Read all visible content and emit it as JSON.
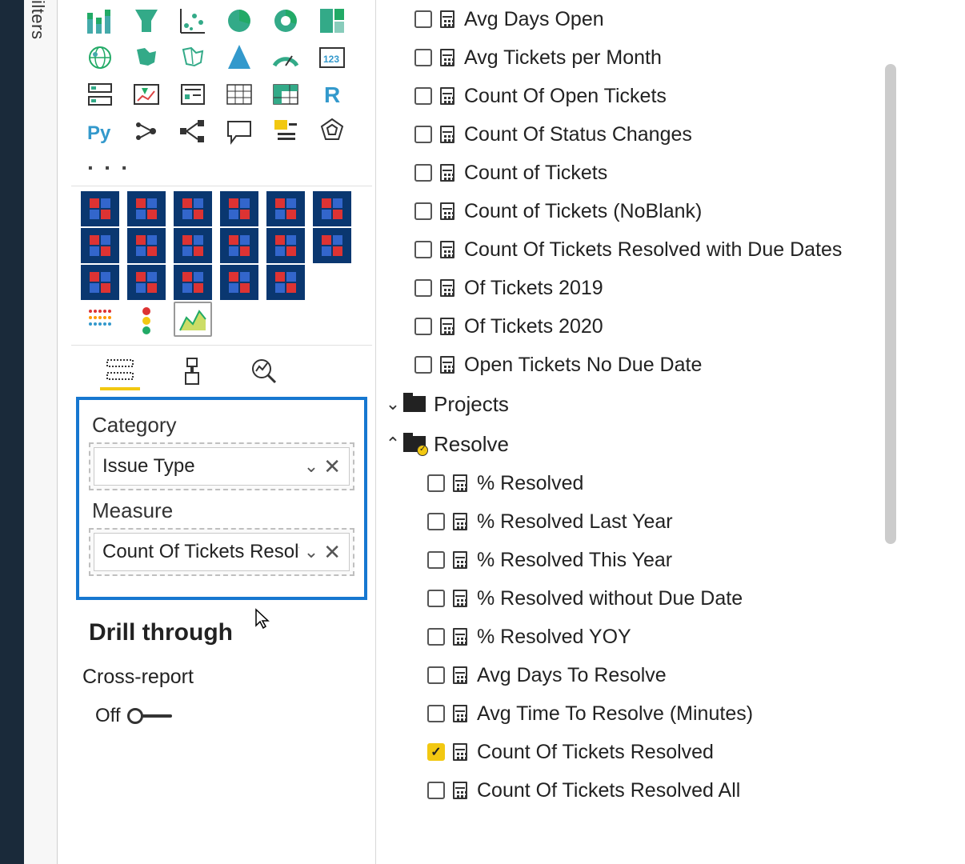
{
  "filters_label": "ilters",
  "ellipsis": "· · ·",
  "wells": {
    "category_label": "Category",
    "category_value": "Issue Type",
    "measure_label": "Measure",
    "measure_value": "Count Of Tickets Resolv"
  },
  "drill": {
    "header": "Drill through",
    "cross_report": "Cross-report",
    "toggle_state": "Off"
  },
  "fields": {
    "measures_group1": [
      "Avg Days Open",
      "Avg Tickets per Month",
      "Count Of Open Tickets",
      "Count Of Status Changes",
      "Count of Tickets",
      "Count of Tickets (NoBlank)",
      "Count Of Tickets Resolved with Due Dates",
      "Of Tickets 2019",
      "Of Tickets 2020",
      "Open Tickets No Due Date"
    ],
    "projects_label": "Projects",
    "resolve_label": "Resolve",
    "resolve_items": [
      {
        "label": "% Resolved",
        "checked": false
      },
      {
        "label": "% Resolved Last Year",
        "checked": false
      },
      {
        "label": "% Resolved This Year",
        "checked": false
      },
      {
        "label": "% Resolved without Due Date",
        "checked": false
      },
      {
        "label": "% Resolved YOY",
        "checked": false
      },
      {
        "label": "Avg Days To Resolve",
        "checked": false
      },
      {
        "label": "Avg Time To Resolve (Minutes)",
        "checked": false
      },
      {
        "label": "Count Of Tickets Resolved",
        "checked": true
      },
      {
        "label": "Count Of Tickets Resolved All",
        "checked": false
      }
    ]
  }
}
